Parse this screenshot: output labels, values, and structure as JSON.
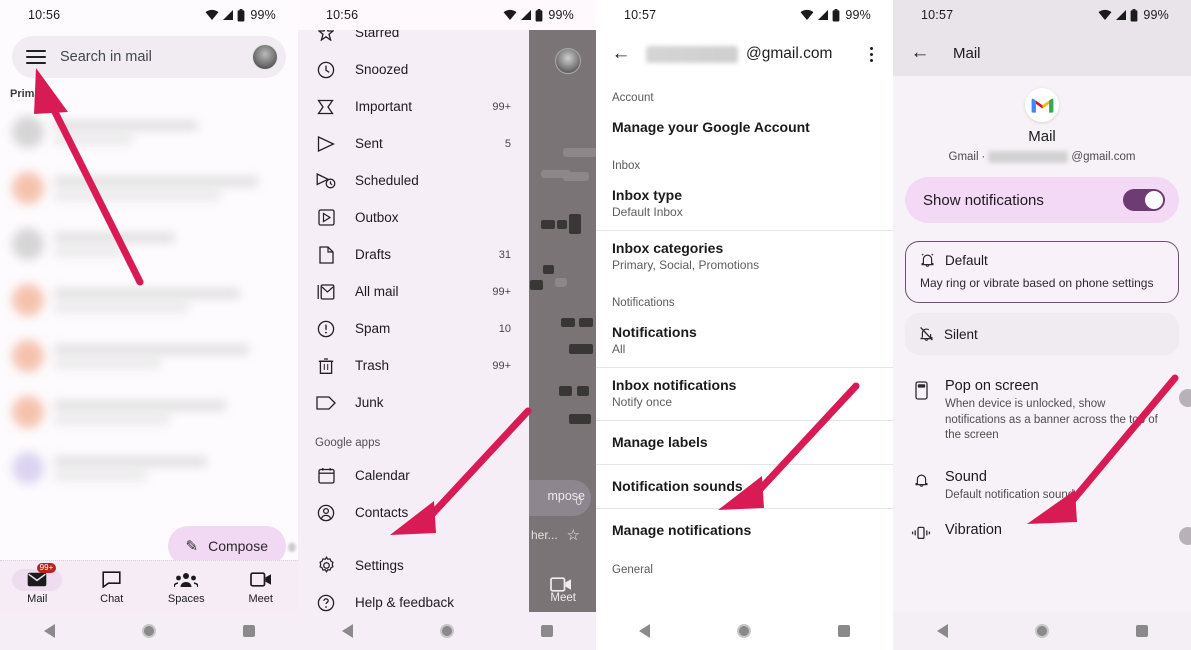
{
  "statusbar": {
    "time_left": "10:56",
    "time_right": "10:57",
    "battery": "99%",
    "icons": [
      "wifi-icon",
      "signal-icon",
      "battery-icon"
    ]
  },
  "panel1": {
    "name": "gmail-inbox",
    "search": {
      "placeholder": "Search in mail",
      "icon": "hamburger-menu-icon",
      "avatar": "account-avatar"
    },
    "category_label": "Primary",
    "compose_label": "Compose",
    "compose_icon": "pencil-icon",
    "overlap_zero": "0",
    "bottom_nav": [
      {
        "label": "Mail",
        "icon": "mail-icon",
        "badge": "99+",
        "active": true
      },
      {
        "label": "Chat",
        "icon": "chat-icon",
        "badge": "",
        "active": false
      },
      {
        "label": "Spaces",
        "icon": "spaces-icon",
        "badge": "",
        "active": false
      },
      {
        "label": "Meet",
        "icon": "meet-video-icon",
        "badge": "",
        "active": false
      }
    ],
    "mail_rows": [
      {
        "avatar": "gray"
      },
      {
        "avatar": "peach"
      },
      {
        "avatar": "gray"
      },
      {
        "avatar": "peach"
      },
      {
        "avatar": "peach"
      },
      {
        "avatar": "peach"
      },
      {
        "avatar": "lilac"
      }
    ]
  },
  "panel2": {
    "name": "gmail-navigation-drawer",
    "items": [
      {
        "label": "Starred",
        "icon": "star-icon",
        "count": ""
      },
      {
        "label": "Snoozed",
        "icon": "clock-icon",
        "count": ""
      },
      {
        "label": "Important",
        "icon": "important-icon",
        "count": "99+"
      },
      {
        "label": "Sent",
        "icon": "send-icon",
        "count": "5"
      },
      {
        "label": "Scheduled",
        "icon": "scheduled-icon",
        "count": ""
      },
      {
        "label": "Outbox",
        "icon": "outbox-icon",
        "count": ""
      },
      {
        "label": "Drafts",
        "icon": "draft-icon",
        "count": "31"
      },
      {
        "label": "All mail",
        "icon": "all-mail-icon",
        "count": "99+"
      },
      {
        "label": "Spam",
        "icon": "spam-icon",
        "count": "10"
      },
      {
        "label": "Trash",
        "icon": "trash-icon",
        "count": "99+"
      },
      {
        "label": "Junk",
        "icon": "junk-tag-icon",
        "count": ""
      }
    ],
    "section_label": "Google apps",
    "apps": [
      {
        "label": "Calendar",
        "icon": "calendar-icon"
      },
      {
        "label": "Contacts",
        "icon": "contacts-icon"
      }
    ],
    "footer": [
      {
        "label": "Settings",
        "icon": "gear-icon"
      },
      {
        "label": "Help & feedback",
        "icon": "help-icon"
      }
    ],
    "dim_compose": "mpose",
    "dim_zero": "0",
    "dim_her": "her...",
    "dim_meet": "Meet"
  },
  "panel3": {
    "name": "gmail-account-settings",
    "header": {
      "account_suffix": "@gmail.com",
      "back_icon": "back-arrow-icon",
      "more_icon": "overflow-menu-icon"
    },
    "sections": [
      {
        "heading": "Account",
        "rows": [
          {
            "title": "Manage your Google Account",
            "subtitle": "",
            "divided": false
          }
        ]
      },
      {
        "heading": "Inbox",
        "rows": [
          {
            "title": "Inbox type",
            "subtitle": "Default Inbox",
            "divided": false
          },
          {
            "title": "Inbox categories",
            "subtitle": "Primary, Social, Promotions",
            "divided": true
          }
        ]
      },
      {
        "heading": "Notifications",
        "rows": [
          {
            "title": "Notifications",
            "subtitle": "All",
            "divided": false
          },
          {
            "title": "Inbox notifications",
            "subtitle": "Notify once",
            "divided": true
          },
          {
            "title": "Manage labels",
            "subtitle": "",
            "divided": true
          },
          {
            "title": "Notification sounds",
            "subtitle": "",
            "divided": true
          },
          {
            "title": "Manage notifications",
            "subtitle": "",
            "divided": true
          }
        ]
      },
      {
        "heading": "General",
        "rows": []
      }
    ]
  },
  "panel4": {
    "name": "android-app-notification-settings",
    "header": {
      "title": "Mail",
      "back_icon": "back-arrow-icon"
    },
    "app": {
      "icon": "gmail-logo-icon",
      "name": "Mail",
      "account_prefix": "Gmail",
      "separator": "·",
      "account_suffix": "@gmail.com"
    },
    "show_notifications": {
      "label": "Show notifications",
      "toggle": "on"
    },
    "importance_options": [
      {
        "label": "Default",
        "icon": "bell-ring-icon",
        "description": "May ring or vibrate based on phone settings",
        "selected": true
      },
      {
        "label": "Silent",
        "icon": "bell-off-icon",
        "description": "",
        "selected": false
      }
    ],
    "preferences": [
      {
        "title": "Pop on screen",
        "subtitle": "When device is unlocked, show notifications as a banner across the top of the screen",
        "icon": "phone-banner-icon",
        "toggle": "off"
      },
      {
        "title": "Sound",
        "subtitle": "Default notification sound",
        "icon": "bell-icon",
        "toggle": ""
      },
      {
        "title": "Vibration",
        "subtitle": "",
        "icon": "vibrate-icon",
        "toggle": "off"
      }
    ]
  },
  "sysnav": {
    "back": "back-triangle-icon",
    "home": "home-circle-icon",
    "recents": "recents-square-icon"
  },
  "annotations": {
    "arrow_color": "#d81b55",
    "arrow_count": 4
  }
}
